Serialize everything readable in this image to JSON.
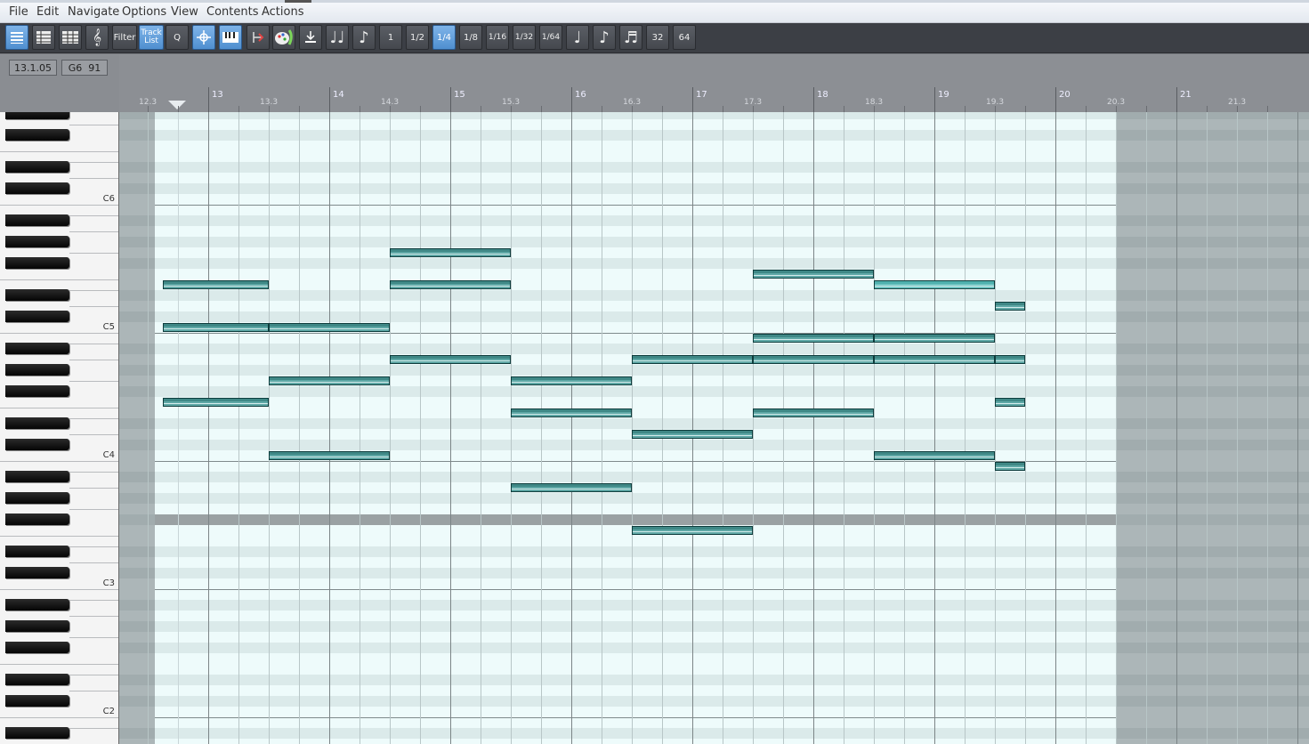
{
  "menu": [
    "File",
    "Edit",
    "Navigate",
    "Options",
    "View",
    "Contents",
    "Actions"
  ],
  "toolbar": {
    "filter_label": "Filter",
    "track_list_label": "Track List",
    "quantize_label": "Q",
    "grid_values": [
      "1",
      "1/2",
      "1/4",
      "1/8",
      "1/16",
      "1/32",
      "1/64"
    ],
    "active_grid": "1/4",
    "tuplet_values": [
      "32",
      "64"
    ],
    "icons": [
      "view-list-icon",
      "view-detail-icon",
      "view-grid-icon",
      "treble-clef-icon",
      "snap-icon",
      "keyboard-icon",
      "loop-icon",
      "paint-icon",
      "step-insert-icon",
      "double-note-icon",
      "eighth-note-icon",
      "quarter-note-icon",
      "eighth-note-2-icon",
      "sixteenth-note-icon"
    ],
    "colors": {
      "active": "#5c9be0",
      "button": "#50545a"
    }
  },
  "info": {
    "position": "13.1.05",
    "note": "G6  91"
  },
  "ruler": {
    "bars": [
      "13",
      "14",
      "15",
      "16",
      "17",
      "18",
      "19",
      "20",
      "21"
    ],
    "halves": [
      "12.3",
      "13.3",
      "14.3",
      "15.3",
      "16.3",
      "17.3",
      "18.3",
      "19.3",
      "20.3",
      "21.3"
    ],
    "playhead": "13.1.05"
  },
  "keyboard": {
    "octave_labels": [
      "C6",
      "C5",
      "C4",
      "C3",
      "C2"
    ]
  },
  "notes": [
    {
      "pitch": "E5",
      "start": "12.3.3",
      "end": "13.3"
    },
    {
      "pitch": "C5",
      "start": "12.3.3",
      "end": "13.3"
    },
    {
      "pitch": "F4",
      "start": "12.3.3",
      "end": "13.3"
    },
    {
      "pitch": "C5",
      "start": "13.3",
      "end": "14.3"
    },
    {
      "pitch": "G4",
      "start": "13.3",
      "end": "14.3"
    },
    {
      "pitch": "C4",
      "start": "13.3",
      "end": "14.3"
    },
    {
      "pitch": "G5",
      "start": "14.3",
      "end": "15.3"
    },
    {
      "pitch": "E5",
      "start": "14.3",
      "end": "15.3"
    },
    {
      "pitch": "A4",
      "start": "14.3",
      "end": "15.3"
    },
    {
      "pitch": "G4",
      "start": "15.3",
      "end": "16.3"
    },
    {
      "pitch": "E4",
      "start": "15.3",
      "end": "16.3"
    },
    {
      "pitch": "A3",
      "start": "15.3",
      "end": "16.3"
    },
    {
      "pitch": "A4",
      "start": "16.3",
      "end": "17.3"
    },
    {
      "pitch": "D4",
      "start": "16.3",
      "end": "17.3"
    },
    {
      "pitch": "F3",
      "start": "16.3",
      "end": "17.3"
    },
    {
      "pitch": "F5",
      "start": "17.3",
      "end": "18.3"
    },
    {
      "pitch": "B4",
      "start": "17.3",
      "end": "18.3"
    },
    {
      "pitch": "A4",
      "start": "17.3",
      "end": "18.3"
    },
    {
      "pitch": "E4",
      "start": "17.3",
      "end": "18.3"
    },
    {
      "pitch": "E5",
      "start": "18.3",
      "end": "19.3"
    },
    {
      "pitch": "B4",
      "start": "18.3",
      "end": "19.3"
    },
    {
      "pitch": "A4",
      "start": "18.3",
      "end": "19.3"
    },
    {
      "pitch": "C4",
      "start": "18.3",
      "end": "19.3"
    },
    {
      "pitch": "D5",
      "start": "19.3",
      "end": "19.4"
    },
    {
      "pitch": "A4",
      "start": "19.3",
      "end": "19.4"
    },
    {
      "pitch": "F4",
      "start": "19.3",
      "end": "19.4"
    },
    {
      "pitch": "B3",
      "start": "19.3",
      "end": "19.4"
    }
  ]
}
